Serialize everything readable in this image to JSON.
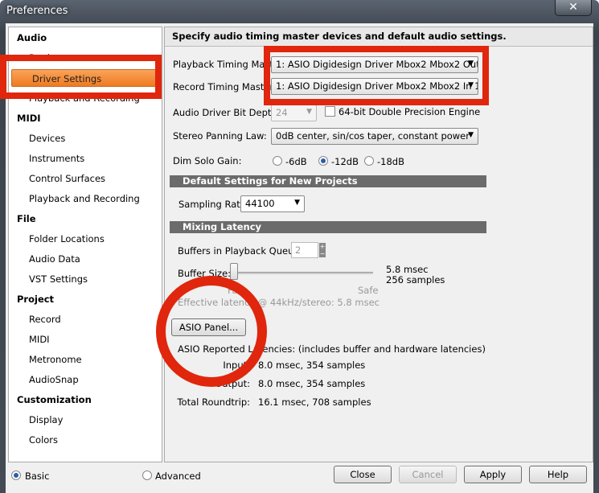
{
  "window": {
    "title": "Preferences",
    "close": "✕"
  },
  "sidebar": {
    "items": [
      {
        "label": "Audio",
        "type": "header"
      },
      {
        "label": "Devices",
        "type": "item"
      },
      {
        "label": "Driver Settings",
        "type": "item",
        "selected": true
      },
      {
        "label": "Playback and Recording",
        "type": "item"
      },
      {
        "label": "MIDI",
        "type": "header"
      },
      {
        "label": "Devices",
        "type": "item"
      },
      {
        "label": "Instruments",
        "type": "item"
      },
      {
        "label": "Control Surfaces",
        "type": "item"
      },
      {
        "label": "Playback and Recording",
        "type": "item"
      },
      {
        "label": "File",
        "type": "header"
      },
      {
        "label": "Folder Locations",
        "type": "item"
      },
      {
        "label": "Audio Data",
        "type": "item"
      },
      {
        "label": "VST Settings",
        "type": "item"
      },
      {
        "label": "Project",
        "type": "header"
      },
      {
        "label": "Record",
        "type": "item"
      },
      {
        "label": "MIDI",
        "type": "item"
      },
      {
        "label": "Metronome",
        "type": "item"
      },
      {
        "label": "AudioSnap",
        "type": "item"
      },
      {
        "label": "Customization",
        "type": "header"
      },
      {
        "label": "Display",
        "type": "item"
      },
      {
        "label": "Colors",
        "type": "item"
      }
    ]
  },
  "main": {
    "header": "Specify audio timing master devices and default audio settings.",
    "playback_master_label": "Playback Timing Master:",
    "playback_master_value": "1: ASIO Digidesign Driver Mbox2 Mbox2 Out 1",
    "record_master_label": "Record Timing Master:",
    "record_master_value": "1: ASIO Digidesign Driver Mbox2 Mbox2 In 1",
    "bit_depth_label": "Audio Driver Bit Depth:",
    "bit_depth_value": "24",
    "double_precision_label": "64-bit Double Precision Engine",
    "panning_label": "Stereo Panning Law:",
    "panning_value": "0dB center, sin/cos taper, constant power",
    "dim_solo_label": "Dim Solo Gain:",
    "dim_options": [
      "-6dB",
      "-12dB",
      "-18dB"
    ],
    "dim_selected": "-12dB",
    "section_defaults": "Default Settings for New Projects",
    "sampling_rate_label": "Sampling Rate:",
    "sampling_rate_value": "44100",
    "section_latency": "Mixing Latency",
    "buffers_label": "Buffers in Playback Queue:",
    "buffers_value": "2",
    "buffer_size_label": "Buffer Size:",
    "buffer_msec": "5.8 msec",
    "buffer_samples": "256 samples",
    "slider_fast": "Fast",
    "slider_safe": "Safe",
    "effective_latency": "Effective latency @ 44kHz/stereo:  5.8 msec",
    "asio_panel_button": "ASIO Panel...",
    "asio_reported": "ASIO Reported Latencies: (includes buffer and hardware latencies)",
    "input_label": "Input:",
    "input_value": "8.0 msec, 354 samples",
    "output_label": "Output:",
    "output_value": "8.0 msec, 354 samples",
    "roundtrip_label": "Total Roundtrip:",
    "roundtrip_value": "16.1 msec, 708 samples"
  },
  "footer": {
    "basic": "Basic",
    "advanced": "Advanced",
    "close": "Close",
    "cancel": "Cancel",
    "apply": "Apply",
    "help": "Help",
    "mode_selected": "Basic"
  },
  "annotation_color": "#e0260d"
}
